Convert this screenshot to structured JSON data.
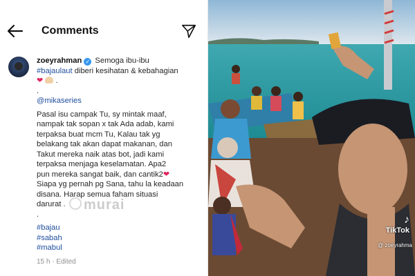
{
  "header": {
    "title": "Comments"
  },
  "comment": {
    "username": "zoeyrahman",
    "line1_text": "Semoga ibu-ibu",
    "tag_bajaulaut": "#bajaulaut",
    "line2_rest": " diberi kesihatan & kebahagian",
    "line3_end": ".",
    "dot": ".",
    "mention": "@mikaseries",
    "paragraph_lines": [
      "Pasal isu campak Tu, sy mintak maaf,",
      "nampak tak sopan x tak Ada adab, kami",
      "terpaksa buat mcm Tu, Kalau tak yg",
      "belakang tak akan dapat makanan, dan",
      "Takut mereka naik atas bot, jadi kami",
      "terpaksa menjaga keselamatan. Apa2",
      "pun mereka sangat baik, dan cantik2",
      "Siapa yg pernah pg Sana, tahu la keadaan",
      "disana. Harap semua faham situasi",
      "darurat ."
    ],
    "dot2": ".",
    "hashtags": [
      "#bajau",
      "#sabah",
      "#mabul"
    ],
    "meta_time": "15 h",
    "meta_sep": " · ",
    "meta_edited": "Edited"
  },
  "watermark": "murai",
  "photo": {
    "logo_text": "TikTok",
    "username": "@ zoeyrahma"
  },
  "colors": {
    "hashtag": "#1f4e9e",
    "heart": "#e0245e",
    "verified": "#3897f0"
  },
  "icons": {
    "back": "back-arrow-icon",
    "send": "send-icon",
    "verified": "verified-badge-icon"
  }
}
